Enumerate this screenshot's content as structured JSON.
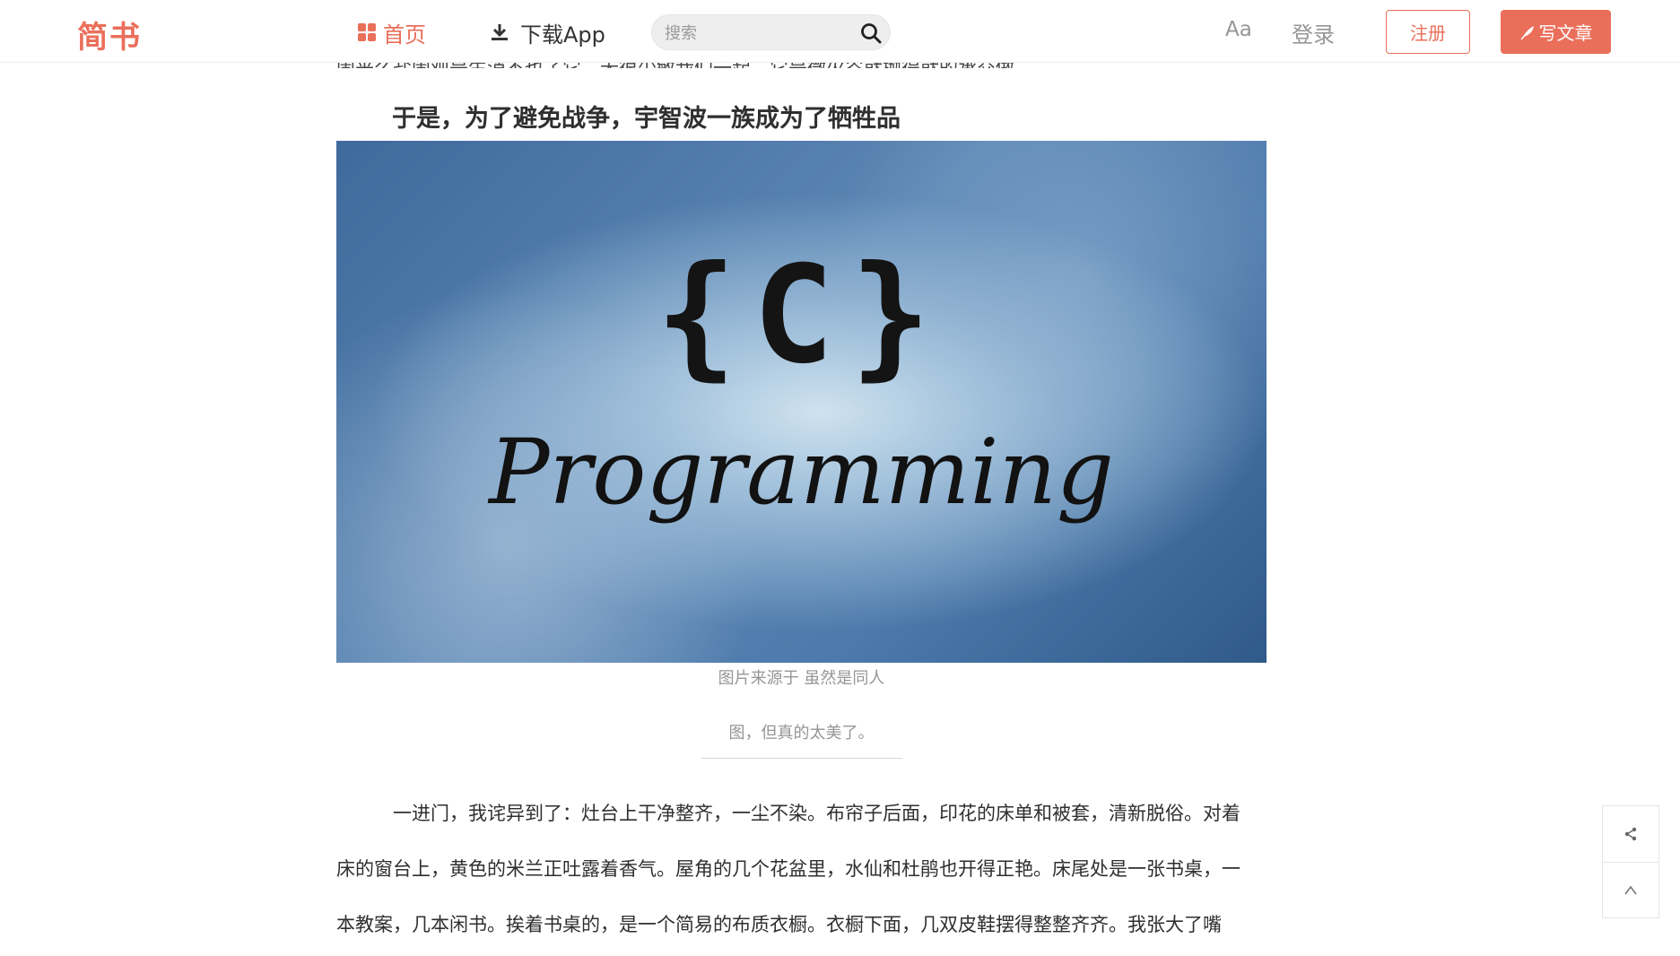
{
  "header": {
    "logo": "简书",
    "nav_home": "首页",
    "nav_download": "下载App",
    "search_placeholder": "搜索",
    "font_toggle": "Aa",
    "login": "登录",
    "register": "注册",
    "write": "写文章",
    "accent_color": "#ea6f5a"
  },
  "article": {
    "cut_off_line": "闹来么盐闹观是生消不也了它。无很少敏我们一起，它是微火谷就抛得就的承交做。",
    "heading": "于是，为了避免战争，宇智波一族成为了牺牲品",
    "image": {
      "brace_text": "{C}",
      "script_text": "Programming"
    },
    "caption_line1": "图片来源于 虽然是同人",
    "caption_line2": "图，但真的太美了。",
    "paragraph_lines": [
      "一进门，我诧异到了：灶台上干净整齐，一尘不染。布帘子后面，印花的床单和被套，清新脱俗。对着",
      "床的窗台上，黄色的米兰正吐露着香气。屋角的几个花盆里，水仙和杜鹃也开得正艳。床尾处是一张书桌，一",
      "本教案，几本闲书。挨着书桌的，是一个简易的布质衣橱。衣橱下面，几双皮鞋摆得整整齐齐。我张大了嘴"
    ]
  },
  "side_tools": {
    "share_icon": "share-icon",
    "top_icon": "back-to-top-icon"
  }
}
